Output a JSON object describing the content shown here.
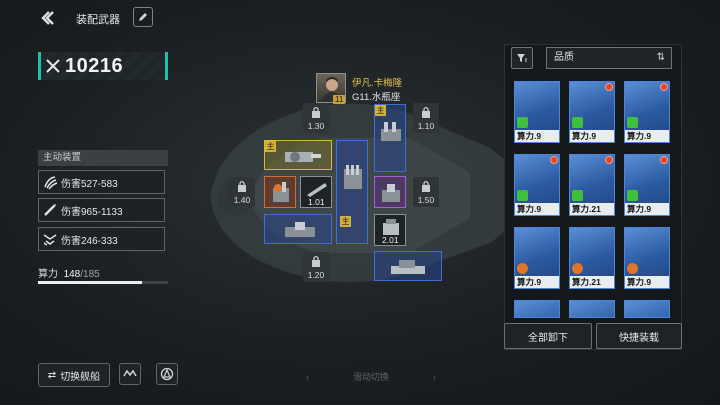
{
  "header": {
    "title": "装配武器"
  },
  "power": {
    "value": "10216"
  },
  "active_equipment": {
    "title": "主动装置",
    "rows": [
      {
        "icon": "claw-icon",
        "label": "伤害527-583"
      },
      {
        "icon": "missile-icon",
        "label": "伤害965-1133"
      },
      {
        "icon": "drone-icon",
        "label": "伤害246-333"
      }
    ]
  },
  "capacity": {
    "label": "算力",
    "current": "148",
    "max": "/185",
    "fraction": 0.8
  },
  "bottom": {
    "switch_ship": "切换舰船",
    "swipe_hint": "滑动切换"
  },
  "captain": {
    "level": "11",
    "name": "伊凡.卡梅隆",
    "ship": "G11.水瓶座"
  },
  "slots": {
    "locks": [
      "1.30",
      "1.10",
      "1.40",
      "1.50",
      "1.20"
    ],
    "values": [
      "1.01",
      "2.01"
    ],
    "main_tag": "主"
  },
  "panel": {
    "quality_label": "品质",
    "cards": [
      {
        "label": "算力.9",
        "tag": "green"
      },
      {
        "label": "算力.9",
        "tag": "green"
      },
      {
        "label": "算力.9",
        "tag": "green"
      },
      {
        "label": "算力.9",
        "tag": "green"
      },
      {
        "label": "算力.21",
        "tag": "green"
      },
      {
        "label": "算力.9",
        "tag": "green"
      },
      {
        "label": "算力.9",
        "tag": "orange"
      },
      {
        "label": "算力.21",
        "tag": "orange"
      },
      {
        "label": "算力.9",
        "tag": "orange"
      }
    ],
    "unload_all": "全部卸下",
    "quick_equip": "快捷装载"
  },
  "colors": {
    "accent": "#19c3a6",
    "slot_blue": "#3b6fd6",
    "slot_gold": "#d4b93a",
    "slot_purple": "#a960d6"
  }
}
